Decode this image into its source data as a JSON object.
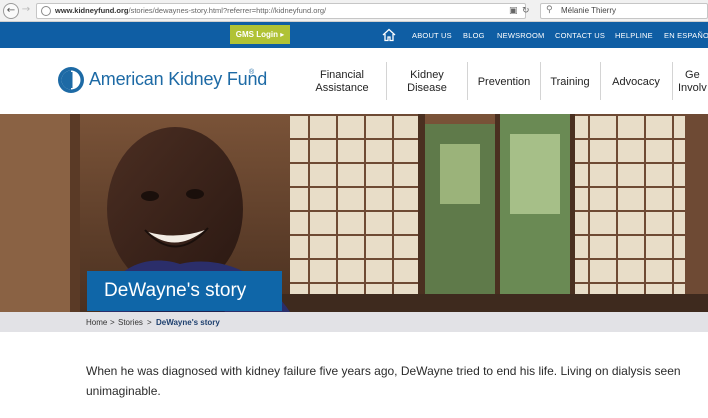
{
  "browser": {
    "url_domain": "www.kidneyfund.org",
    "url_path": "/stories/dewaynes-story.html?referrer=http://kidneyfund.org/",
    "search_value": "Mélanie Thierry"
  },
  "top_nav": {
    "gms_login": "GMS Login ▸",
    "links": [
      "ABOUT US",
      "BLOG",
      "NEWSROOM",
      "CONTACT US",
      "HELPLINE",
      "EN ESPAÑOL"
    ]
  },
  "header": {
    "logo_text": "American Kidney Fund",
    "logo_mark": "®",
    "menu": [
      {
        "line1": "Financial",
        "line2": "Assistance"
      },
      {
        "line1": "Kidney",
        "line2": "Disease"
      },
      {
        "line1": "Prevention",
        "line2": ""
      },
      {
        "line1": "Training",
        "line2": ""
      },
      {
        "line1": "Advocacy",
        "line2": ""
      },
      {
        "line1": "Ge",
        "line2": "Involv"
      }
    ]
  },
  "hero": {
    "title": "DeWayne's story"
  },
  "breadcrumb": {
    "home": "Home",
    "stories": "Stories",
    "current": "DeWayne's story",
    "separator": ">"
  },
  "content": {
    "line1": "When he was diagnosed with kidney failure five years ago, DeWayne tried to end his life. Living on dialysis seen",
    "line2": "unimaginable."
  },
  "colors": {
    "nav_blue": "#0f5ea4",
    "gms_green": "#b0c235",
    "title_blue": "#0f66a8",
    "breadcrumb_bg": "#e2e2e6"
  }
}
